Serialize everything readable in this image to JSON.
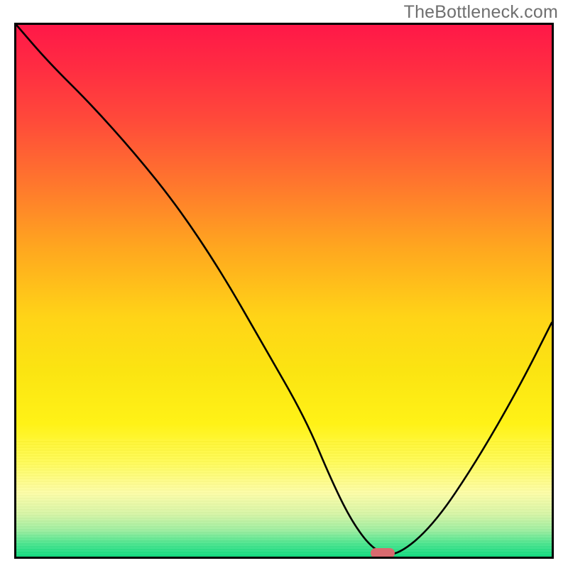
{
  "watermark": {
    "text": "TheBottleneck.com"
  },
  "chart_data": {
    "type": "line",
    "title": "",
    "xlabel": "",
    "ylabel": "",
    "xlim": [
      0,
      100
    ],
    "ylim": [
      0,
      100
    ],
    "grid": false,
    "legend": false,
    "series": [
      {
        "name": "bottleneck-curve",
        "x": [
          0,
          6,
          14,
          22,
          30,
          38,
          46,
          54,
          59,
          63,
          67,
          71,
          78,
          86,
          94,
          100
        ],
        "y": [
          100,
          93,
          85,
          76,
          66,
          54,
          40,
          26,
          14,
          6,
          1,
          0,
          6,
          18,
          32,
          44
        ]
      }
    ],
    "marker": {
      "name": "optimal-point",
      "x": 68.5,
      "y": 0.6,
      "color": "#d86a6f"
    },
    "background_gradient": {
      "top": "#ff1848",
      "mid": "#ffd417",
      "bottom": "#12db80"
    }
  }
}
